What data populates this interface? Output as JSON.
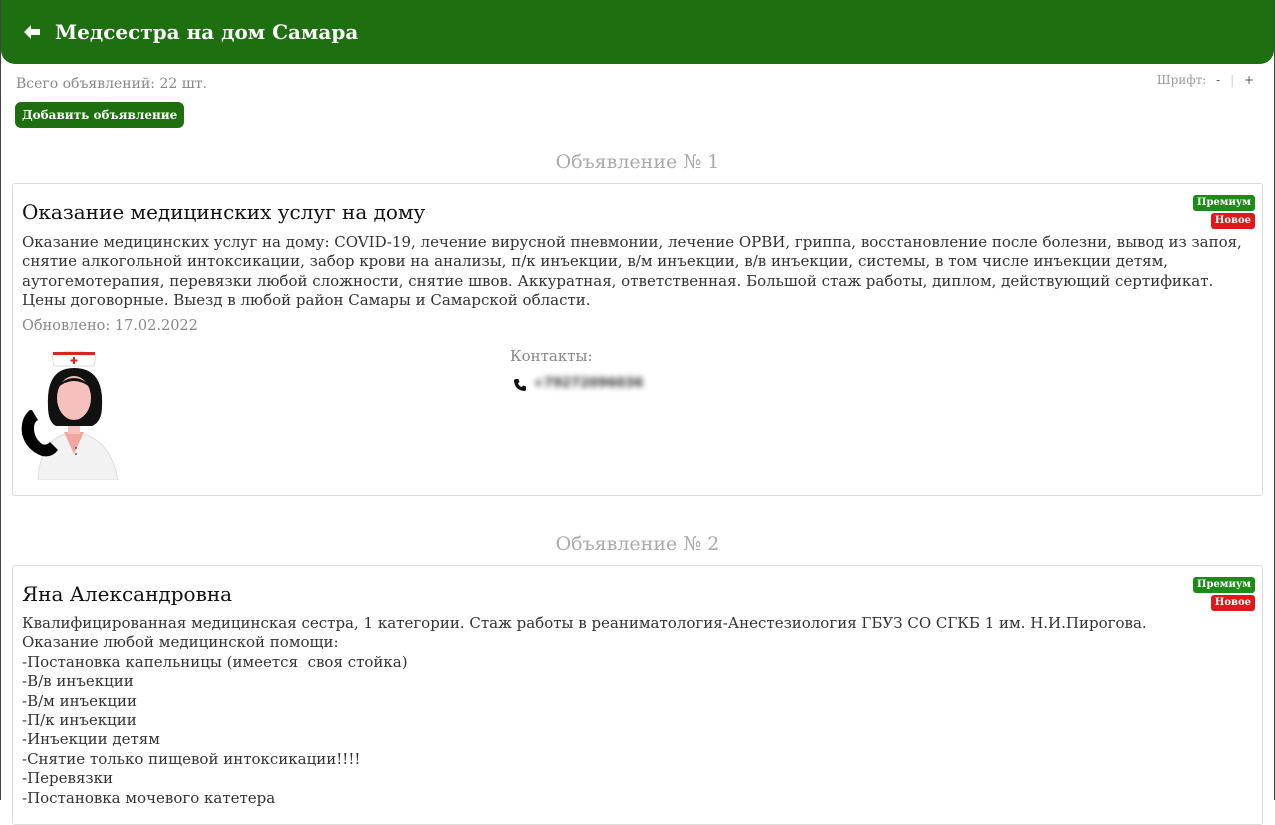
{
  "header": {
    "back_icon": "arrow-left-icon",
    "title": "Медсестра на дом Самара"
  },
  "summary": {
    "total": "Всего объявлений: 22 шт."
  },
  "font_control": {
    "label": "Шрифт:",
    "decrease": "-",
    "separator": "|",
    "increase": "+"
  },
  "add_button": "Добавить объявление",
  "colors": {
    "brand_green": "#1e6f0f",
    "premium_badge": "#1e8a1a",
    "new_badge": "#e0181a"
  },
  "ads": [
    {
      "number": "Объявление № 1",
      "title": "Оказание медицинских услуг на дому",
      "badges": {
        "premium": "Премиум",
        "new": "Новое"
      },
      "text_lines": [
        "Оказание медицинских услуг на дому: COVID-19, лечение вирусной пневмонии, лечение ОРВИ, гриппа, восстановление после болезни, вывод из запоя,",
        "снятие алкогольной интоксикации, забор крови на анализы, п/к инъекции, в/м инъекции, в/в инъекции, системы, в том числе инъекции детям,",
        "аутогемотерапия, перевязки любой сложности, снятие швов. Аккуратная, ответственная. Большой стаж работы, диплом, действующий сертификат.",
        "Цены договорные. Выезд в любой район Самары и Самарской области."
      ],
      "updated": "Обновлено: 17.02.2022",
      "avatar_icon": "nurse-phone-icon",
      "contacts_label": "Контакты:",
      "phone_icon": "phone-icon",
      "phone": "+79272096036"
    },
    {
      "number": "Объявление № 2",
      "title": "Яна Александровна",
      "badges": {
        "premium": "Премиум",
        "new": "Новое"
      },
      "text_lines": [
        "Квалифицированная медицинская сестра, 1 категории. Стаж работы в реаниматология-Анестезиология ГБУЗ СО СГКБ 1 им. Н.И.Пирогова.",
        "Оказание любой медицинской помощи:",
        "-Постановка капельницы (имеется  своя стойка)",
        "-В/в инъекции",
        "-В/м инъекции",
        "-П/к инъекции",
        "-Инъекции детям",
        "-Снятие только пищевой интоксикации!!!!",
        "-Перевязки",
        "-Постановка мочевого катетера"
      ]
    }
  ]
}
